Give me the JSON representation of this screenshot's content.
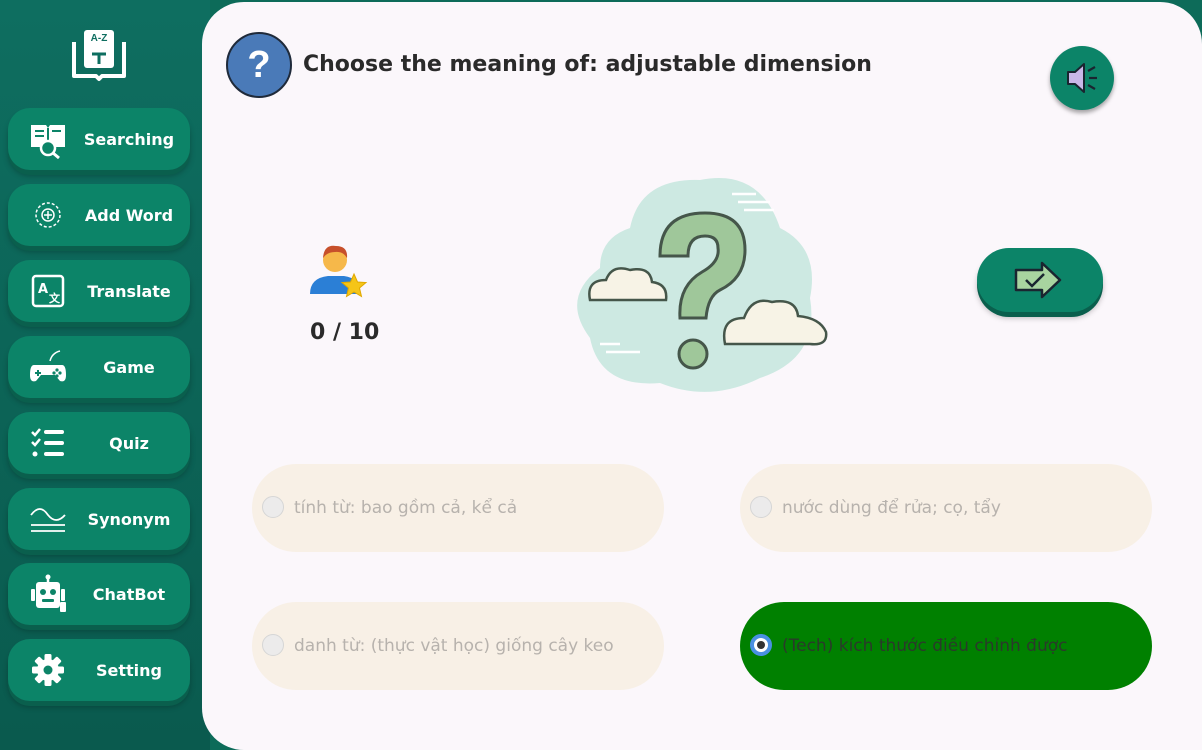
{
  "sidebar": {
    "logo_icon": "dictionary-book-icon",
    "logo_text": "A-Z",
    "items": [
      {
        "label": "Searching",
        "icon": "book-search-icon"
      },
      {
        "label": "Add Word",
        "icon": "plus-circle-icon"
      },
      {
        "label": "Translate",
        "icon": "translate-icon"
      },
      {
        "label": "Game",
        "icon": "gamepad-icon"
      },
      {
        "label": "Quiz",
        "icon": "checklist-icon"
      },
      {
        "label": "Synonym",
        "icon": "waves-icon"
      },
      {
        "label": "ChatBot",
        "icon": "robot-icon"
      },
      {
        "label": "Setting",
        "icon": "gear-icon"
      }
    ]
  },
  "quiz": {
    "question": "Choose the meaning of: adjustable dimension",
    "question_icon": "question-mark-icon",
    "speaker_icon": "speaker-icon",
    "score": "0 / 10",
    "score_icon": "user-star-icon",
    "next_icon": "next-arrow-icon",
    "options": [
      {
        "text": "tính từ: bao gồm cả, kể cả",
        "selected": false
      },
      {
        "text": "nước dùng để rửa; cọ, tẩy",
        "selected": false
      },
      {
        "text": "danh từ: (thực vật học) giống cây keo",
        "selected": false
      },
      {
        "text": "(Tech) kích thước điều chỉnh được",
        "selected": true
      }
    ]
  },
  "colors": {
    "sidebar_bg": "#0e6e60",
    "button_green": "#0c8468",
    "selected_option": "#008000",
    "option_bg": "#f8f0e6",
    "main_bg": "#fbf7fb"
  }
}
